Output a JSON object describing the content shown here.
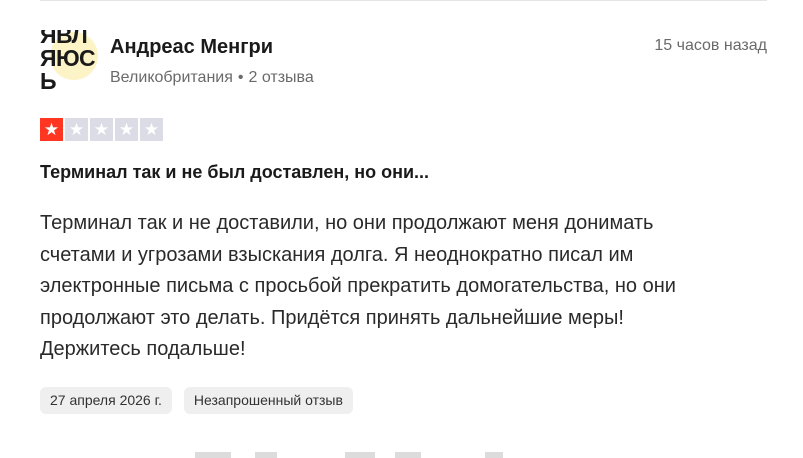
{
  "review": {
    "avatar": {
      "lines": [
        "ЯВЛ",
        "ЯЮС",
        "Ь"
      ],
      "color": "#fcf3c6"
    },
    "reviewer": {
      "name": "Андреас Менгри",
      "country": "Великобритания",
      "separator": "•",
      "review_count": "2 отзыва"
    },
    "timestamp": "15 часов назад",
    "rating": {
      "value": 1,
      "max": 5,
      "filled_color": "#ff3722",
      "empty_color": "#dcdce6"
    },
    "title": "Терминал так и не был доставлен, но они...",
    "body_lines": [
      "Терминал так и не доставили, но они продолжают меня донимать",
      "счетами и угрозами взыскания долга. Я неоднократно писал им",
      "электронные письма с просьбой прекратить домогательства, но они",
      "продолжают это делать. Придётся принять дальнейшие меры!",
      "Держитесь подальше!"
    ],
    "tags": {
      "date": "27 апреля 2026 г.",
      "type": "Незапрошенный отзыв"
    }
  }
}
